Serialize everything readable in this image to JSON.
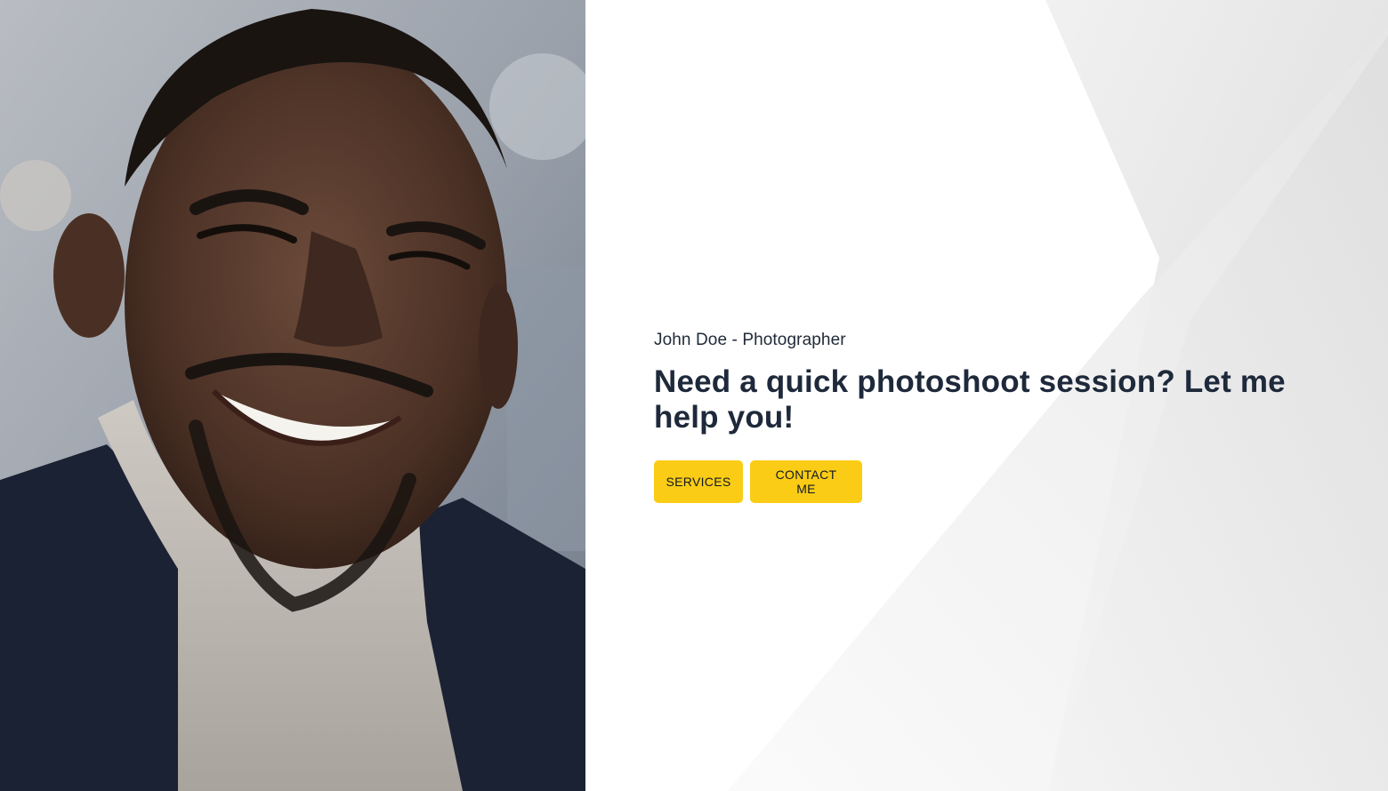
{
  "hero": {
    "photo_alt": "Portrait of smiling photographer",
    "subtitle": "John Doe - Photographer",
    "headline": "Need a quick photoshoot session? Let me help you!",
    "buttons": {
      "services_label": "SERVICES",
      "contact_label": "CONTACT ME"
    }
  },
  "colors": {
    "accent": "#facc15",
    "heading": "#1e293b",
    "text": "#1f2937",
    "background": "#ffffff"
  }
}
